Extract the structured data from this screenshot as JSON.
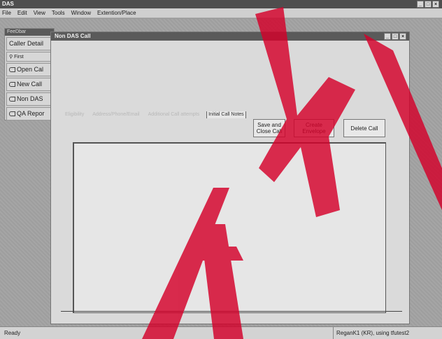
{
  "app": {
    "title": "DAS",
    "window_controls": [
      "_",
      "□",
      "×"
    ]
  },
  "menu": [
    "File",
    "Edit",
    "View",
    "Tools",
    "Window",
    "Extention/Place"
  ],
  "toolbox": {
    "title": "FeeDbar",
    "items": [
      {
        "label": "Caller Detail",
        "icon": "none"
      },
      {
        "label": "First",
        "icon": "binoculars-icon"
      },
      {
        "label": "Open Cal",
        "icon": "phone-icon"
      },
      {
        "label": "New Call",
        "icon": "phone-icon"
      },
      {
        "label": "Non DAS",
        "icon": "phone-icon"
      },
      {
        "label": "QA Repor",
        "icon": "phone-icon"
      }
    ]
  },
  "child_window": {
    "title": "Non DAS Call",
    "controls": [
      "_",
      "□",
      "×"
    ],
    "tabs": [
      "Eligibility",
      "Address/Phone/Email",
      "Additional Call attempts",
      "Initial Call Notes"
    ],
    "active_tab": 3,
    "buttons": {
      "save": "Save and Close Call",
      "envelope": "Create Envelope",
      "delete": "Delete Call"
    }
  },
  "status": {
    "left": "Ready",
    "right": "ReganK1 (KR), using tfutest2"
  },
  "colors": {
    "title_bar": "#4e4e4e",
    "watermark": "#d4002a",
    "background": "#9a9a9a"
  }
}
